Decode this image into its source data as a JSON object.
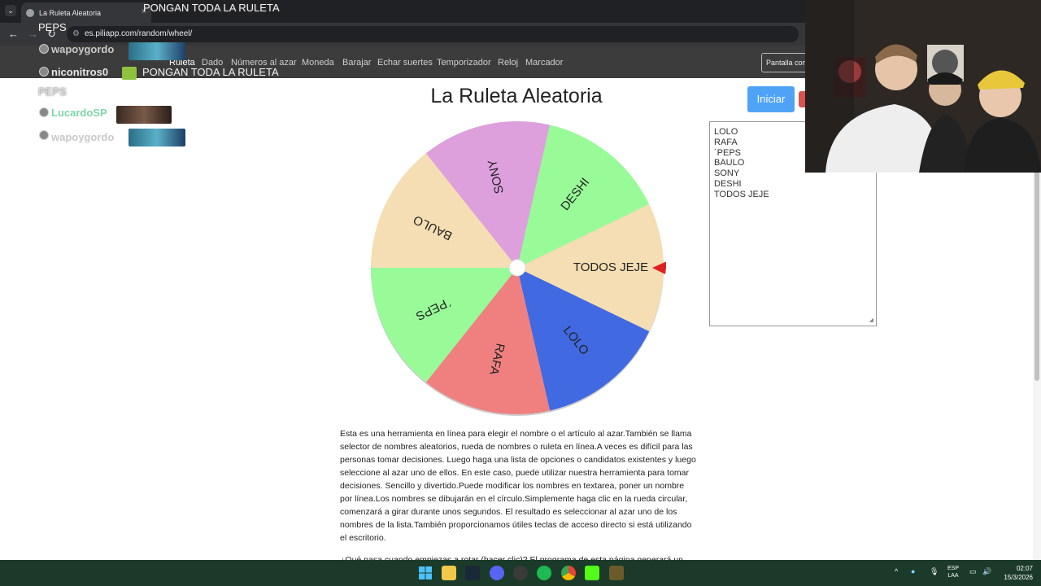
{
  "browser": {
    "tab_title": "La Ruleta Aleatoria",
    "url": "es.piliapp.com/random/wheel/"
  },
  "site_nav": {
    "items": [
      "Ruleta",
      "Dado",
      "Números al azar",
      "Moneda",
      "Barajar",
      "Echar suertes",
      "Temporizador",
      "Reloj",
      "Marcador"
    ],
    "fullscreen_label": "Pantalla completa"
  },
  "page": {
    "title": "La Ruleta Aleatoria",
    "start_label": "Iniciar",
    "names": [
      "LOLO",
      "RAFA",
      "´PEPS",
      "BAULO",
      "SONY",
      "DESHI",
      "TODOS JEJE"
    ],
    "description": "Esta es una herramienta en línea para elegir el nombre o el artículo al azar.También se llama selector de nombres aleatorios, rueda de nombres o ruleta en línea.A veces es difícil para las personas tomar decisiones. Luego haga una lista de opciones o candidatos existentes y luego seleccione al azar uno de ellos. En este caso, puede utilizar nuestra herramienta para tomar decisiones. Sencillo y divertido.Puede modificar los nombres en textarea, poner un nombre por línea.Los nombres se dibujarán en el círculo.Simplemente haga clic en la rueda circular, comenzará a girar durante unos segundos. El resultado es seleccionar al azar uno de los nombres de la lista.También proporcionamos útiles teclas de acceso directo si está utilizando el escritorio.",
    "description_cut": "¿Qué pasa cuando empiezas a rotar (hacer clic)? El programa de esta página generará un"
  },
  "wheel": {
    "segments": [
      {
        "label": "TODOS JEJE",
        "color": "#f5deb3"
      },
      {
        "label": "LOLO",
        "color": "#4169e1"
      },
      {
        "label": "RAFA",
        "color": "#f08080"
      },
      {
        "label": "´PEPS",
        "color": "#98fb98"
      },
      {
        "label": "BAULO",
        "color": "#f5deb3"
      },
      {
        "label": "SONY",
        "color": "#dda0dd"
      },
      {
        "label": "DESHI",
        "color": "#98fb98"
      }
    ],
    "pointer_color": "#e02020"
  },
  "chat": {
    "top_partial": "PONGAN TODA LA RULETA",
    "lines": [
      {
        "kind": "plain",
        "text": "PEPS"
      },
      {
        "kind": "user",
        "user": "wapoygordo",
        "color": "#c9c9c9"
      },
      {
        "kind": "user",
        "user": "niconitros0",
        "color": "#e6e6e6",
        "message": "PONGAN TODA LA RULETA"
      },
      {
        "kind": "plain",
        "text": "PEPS"
      },
      {
        "kind": "user",
        "user": "LucardoSP",
        "color": "#7fd6a8"
      },
      {
        "kind": "user",
        "user": "wapoygordo",
        "color": "#c9c9c9"
      }
    ]
  },
  "taskbar": {
    "lang_top": "ESP",
    "lang_bottom": "LAA",
    "time": "02:07",
    "date": "15/3/2026"
  }
}
